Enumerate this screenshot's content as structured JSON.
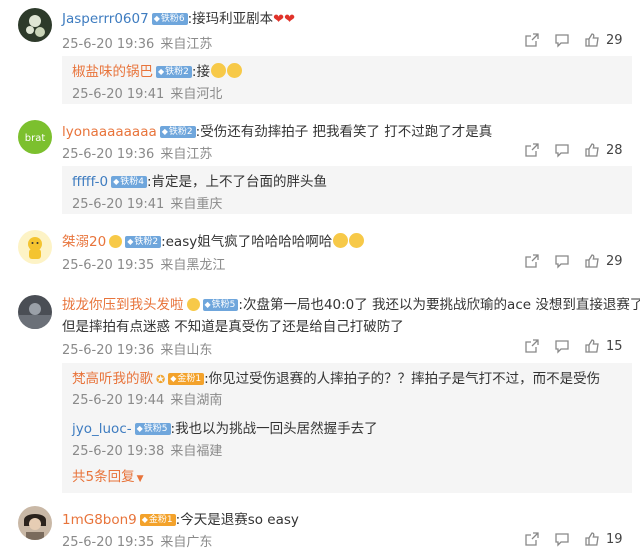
{
  "icons": {
    "share": "share-icon",
    "comment": "comment-icon",
    "like": "thumbs-up-icon",
    "badge": "badge-icon",
    "emoji": "emoji-icon",
    "heart": "heart-icon"
  },
  "colors": {
    "username": "#e8743b",
    "username_blue": "#3e7cc0",
    "badge": "#6fa6dc",
    "badge_gold": "#f3a22b",
    "meta": "#8a8a8a"
  },
  "comments": [
    {
      "user": "Jasperrr0607",
      "badge": "铁粉6",
      "text": ":接玛利亚剧本",
      "time": "25-6-20 19:36",
      "location": "来自江苏",
      "likes": "29",
      "replies": [
        {
          "user": "椒盐味的锅巴",
          "badge": "铁粉2",
          "text": ":接",
          "time": "25-6-20 19:41",
          "location": "来自河北"
        }
      ]
    },
    {
      "user": "lyonaaaaaaaa",
      "badge": "铁粉2",
      "text": ":受伤还有劲摔拍子 把我看笑了 打不过跑了才是真",
      "time": "25-6-20 19:36",
      "location": "来自江苏",
      "likes": "28",
      "replies": [
        {
          "user": "fffff-0",
          "badge": "铁粉4",
          "text": ":肯定是，上不了台面的胖头鱼",
          "time": "25-6-20 19:41",
          "location": "来自重庆"
        }
      ]
    },
    {
      "user": "桀溺20",
      "badge": "铁粉2",
      "text": ":easy姐气疯了哈哈哈哈啊哈",
      "time": "25-6-20 19:35",
      "location": "来自黑龙江",
      "likes": "29"
    },
    {
      "user": "拢龙你压到我头发啦",
      "badge": "铁粉5",
      "text": ":次盘第一局也40:0了 我还以为要挑战欣瑜的ace 没想到直接退赛了",
      "text2": "但是摔拍有点迷惑 不知道是真受伤了还是给自己打破防了",
      "time": "25-6-20 19:36",
      "location": "来自山东",
      "likes": "15",
      "replies": [
        {
          "user": "梵高听我的歌",
          "badge": "金粉1",
          "text": ":你见过受伤退赛的人摔拍子的？？摔拍子是气打不过，而不是受伤",
          "time": "25-6-20 19:44",
          "location": "来自湖南"
        },
        {
          "user": "jyo_luoc-",
          "badge": "铁粉5",
          "text": ":我也以为挑战一回头居然握手去了",
          "time": "25-6-20 19:38",
          "location": "来自福建"
        }
      ],
      "more": "共5条回复"
    },
    {
      "user": "1mG8bon9",
      "badge": "金粉1",
      "text": ":今天是退赛so easy",
      "time": "25-6-20 19:35",
      "location": "来自广东",
      "likes": "19"
    }
  ]
}
